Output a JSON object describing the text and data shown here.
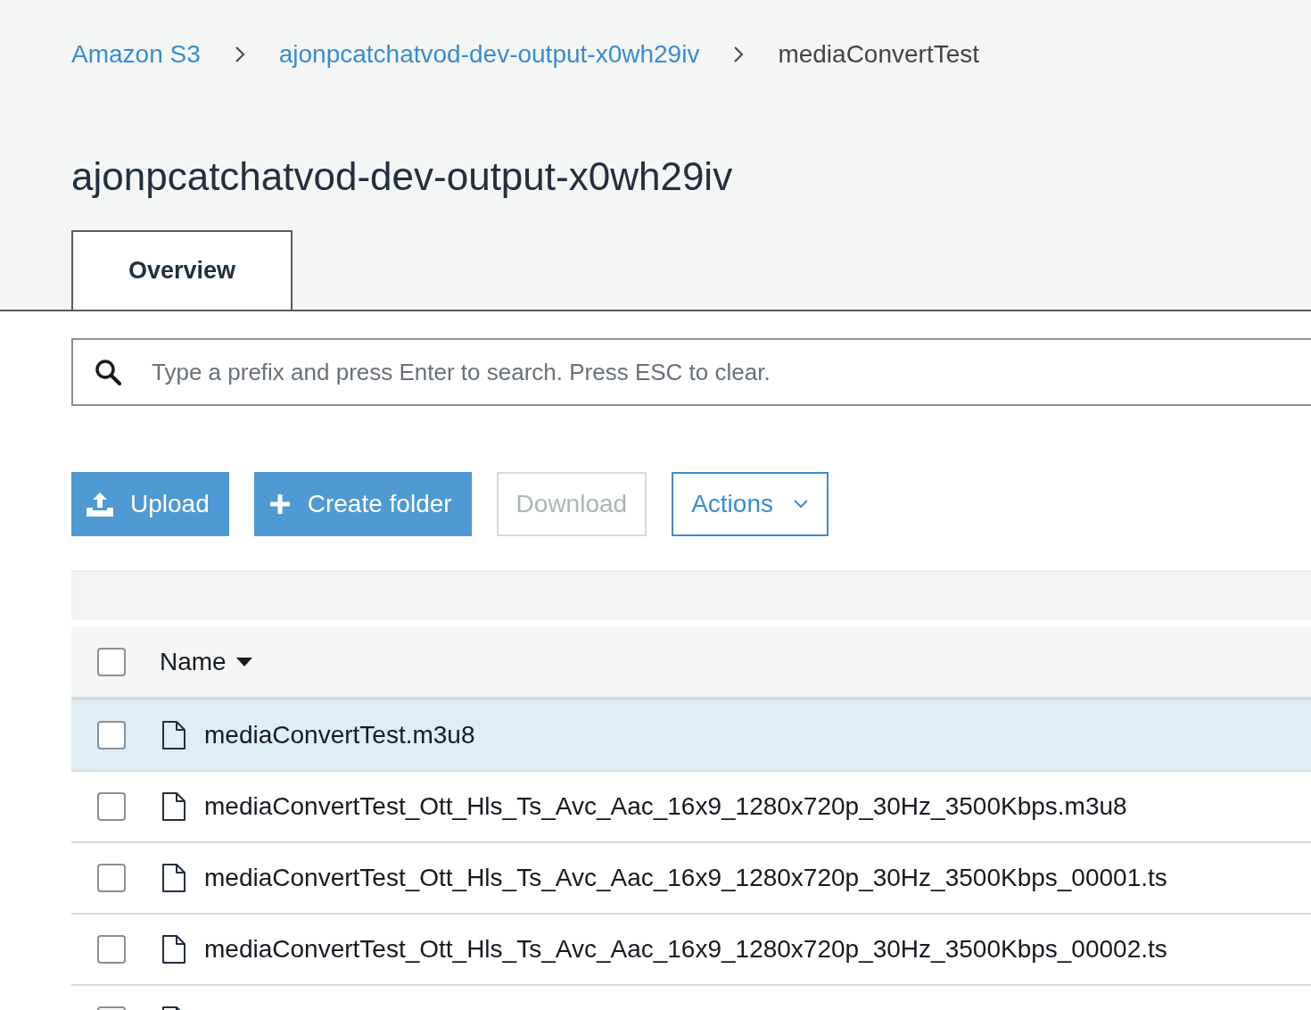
{
  "breadcrumb": [
    {
      "label": "Amazon S3",
      "current": false
    },
    {
      "label": "ajonpcatchatvod-dev-output-x0wh29iv",
      "current": false
    },
    {
      "label": "mediaConvertTest",
      "current": true
    }
  ],
  "title": "ajonpcatchatvod-dev-output-x0wh29iv",
  "tabs": [
    {
      "label": "Overview",
      "selected": true
    }
  ],
  "search": {
    "placeholder": "Type a prefix and press Enter to search. Press ESC to clear."
  },
  "buttons": [
    {
      "label": "Upload",
      "kind": "upload",
      "disabled": false
    },
    {
      "label": "Create folder",
      "kind": "add",
      "disabled": false
    },
    {
      "label": "Download",
      "kind": "plain",
      "disabled": true
    },
    {
      "label": "Actions",
      "kind": "menu",
      "disabled": false
    }
  ],
  "table": {
    "all_checked": false,
    "columns": [
      {
        "label": "Name",
        "sorted": true
      }
    ],
    "rows": [
      {
        "name": "mediaConvertTest.m3u8",
        "selected": true,
        "checked": false
      },
      {
        "name": "mediaConvertTest_Ott_Hls_Ts_Avc_Aac_16x9_1280x720p_30Hz_3500Kbps.m3u8",
        "selected": false,
        "checked": false
      },
      {
        "name": "mediaConvertTest_Ott_Hls_Ts_Avc_Aac_16x9_1280x720p_30Hz_3500Kbps_00001.ts",
        "selected": false,
        "checked": false
      },
      {
        "name": "mediaConvertTest_Ott_Hls_Ts_Avc_Aac_16x9_1280x720p_30Hz_3500Kbps_00002.ts",
        "selected": false,
        "checked": false
      },
      {
        "selected": false
      }
    ]
  }
}
